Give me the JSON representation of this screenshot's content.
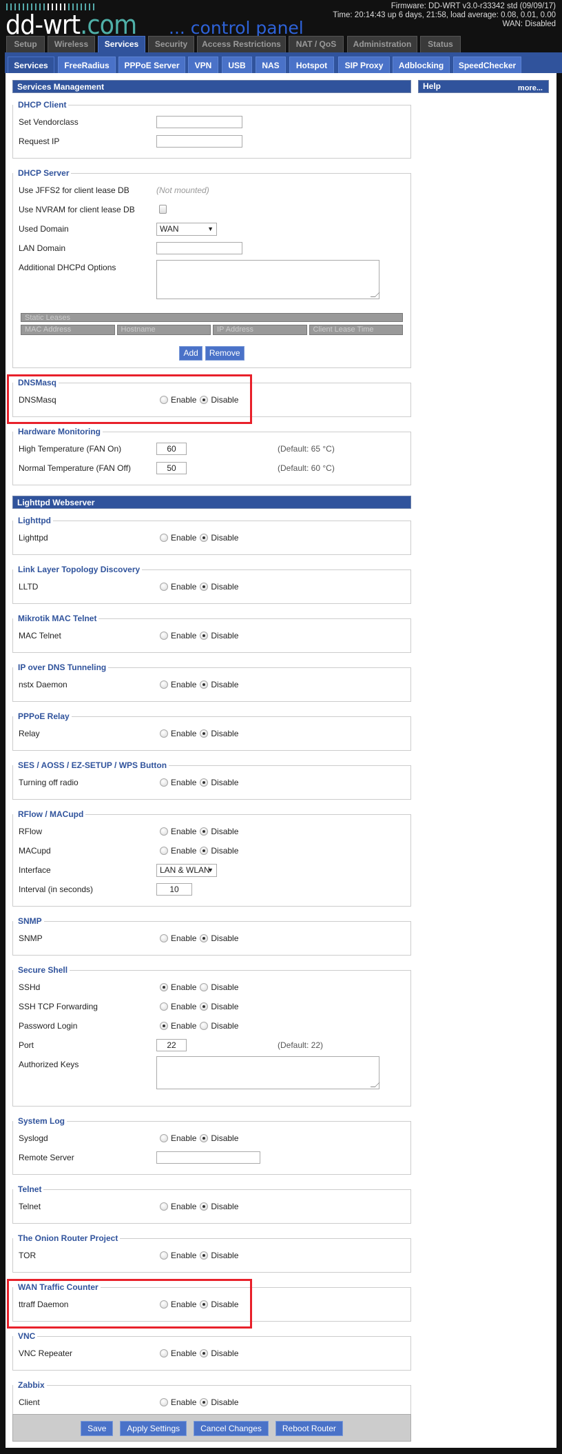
{
  "header": {
    "logo_main": "dd-wrt",
    "logo_suffix": ".com",
    "logo_tagline": "... control panel",
    "firmware": "Firmware: DD-WRT v3.0-r33342 std (09/09/17)",
    "time": "Time: 20:14:43 up 6 days, 21:58, load average: 0.08, 0.01, 0.00",
    "wan": "WAN: Disabled"
  },
  "tabs": [
    {
      "label": "Setup",
      "active": false
    },
    {
      "label": "Wireless",
      "active": false
    },
    {
      "label": "Services",
      "active": true
    },
    {
      "label": "Security",
      "active": false
    },
    {
      "label": "Access Restrictions",
      "active": false
    },
    {
      "label": "NAT / QoS",
      "active": false
    },
    {
      "label": "Administration",
      "active": false
    },
    {
      "label": "Status",
      "active": false
    }
  ],
  "subtabs": [
    {
      "label": "Services",
      "active": true
    },
    {
      "label": "FreeRadius",
      "active": false
    },
    {
      "label": "PPPoE Server",
      "active": false
    },
    {
      "label": "VPN",
      "active": false
    },
    {
      "label": "USB",
      "active": false
    },
    {
      "label": "NAS",
      "active": false
    },
    {
      "label": "Hotspot",
      "active": false
    },
    {
      "label": "SIP Proxy",
      "active": false
    },
    {
      "label": "Adblocking",
      "active": false
    },
    {
      "label": "SpeedChecker",
      "active": false
    }
  ],
  "help": {
    "title": "Help",
    "more": "more..."
  },
  "radio_labels": {
    "enable": "Enable",
    "disable": "Disable"
  },
  "colors": {
    "brand_blue": "#30539c",
    "button_blue": "#4a72c8",
    "highlight_red": "#e8202a"
  },
  "groups": [
    {
      "title": "Services Management",
      "fieldsets": [
        {
          "legend": "DHCP Client",
          "rows": [
            {
              "label": "Set Vendorclass",
              "type": "text",
              "value": ""
            },
            {
              "label": "Request IP",
              "type": "text",
              "value": ""
            }
          ]
        },
        {
          "legend": "DHCP Server",
          "rows": [
            {
              "label": "Use JFFS2 for client lease DB",
              "type": "note",
              "value": "(Not mounted)"
            },
            {
              "label": "Use NVRAM for client lease DB",
              "type": "checkbox",
              "checked": false
            },
            {
              "label": "Used Domain",
              "type": "select",
              "value": "WAN"
            },
            {
              "label": "LAN Domain",
              "type": "text",
              "value": ""
            },
            {
              "label": "Additional DHCPd Options",
              "type": "textarea",
              "value": ""
            }
          ],
          "table": {
            "title": "Static Leases",
            "columns": [
              "MAC Address",
              "Hostname",
              "IP Address",
              "Client Lease Time"
            ]
          },
          "buttons": [
            "Add",
            "Remove"
          ]
        },
        {
          "legend": "DNSMasq",
          "highlighted": true,
          "rows": [
            {
              "label": "DNSMasq",
              "type": "radio",
              "enabled": false
            }
          ]
        },
        {
          "legend": "Hardware Monitoring",
          "rows": [
            {
              "label": "High Temperature (FAN On)",
              "type": "number",
              "value": "60",
              "default": "(Default: 65 °C)"
            },
            {
              "label": "Normal Temperature (FAN Off)",
              "type": "number",
              "value": "50",
              "default": "(Default: 60 °C)"
            }
          ]
        }
      ]
    },
    {
      "title": "Lighttpd Webserver",
      "fieldsets": [
        {
          "legend": "Lighttpd",
          "rows": [
            {
              "label": "Lighttpd",
              "type": "radio",
              "enabled": false
            }
          ]
        },
        {
          "legend": "Link Layer Topology Discovery",
          "rows": [
            {
              "label": "LLTD",
              "type": "radio",
              "enabled": false
            }
          ]
        },
        {
          "legend": "Mikrotik MAC Telnet",
          "rows": [
            {
              "label": "MAC Telnet",
              "type": "radio",
              "enabled": false
            }
          ]
        },
        {
          "legend": "IP over DNS Tunneling",
          "rows": [
            {
              "label": "nstx Daemon",
              "type": "radio",
              "enabled": false
            }
          ]
        },
        {
          "legend": "PPPoE Relay",
          "rows": [
            {
              "label": "Relay",
              "type": "radio",
              "enabled": false
            }
          ]
        },
        {
          "legend": "SES / AOSS / EZ-SETUP / WPS Button",
          "rows": [
            {
              "label": "Turning off radio",
              "type": "radio",
              "enabled": false
            }
          ]
        },
        {
          "legend": "RFlow / MACupd",
          "rows": [
            {
              "label": "RFlow",
              "type": "radio",
              "enabled": false
            },
            {
              "label": "MACupd",
              "type": "radio",
              "enabled": false
            },
            {
              "label": "Interface",
              "type": "select",
              "value": "LAN & WLAN"
            },
            {
              "label": "Interval (in seconds)",
              "type": "number",
              "value": "10"
            }
          ]
        },
        {
          "legend": "SNMP",
          "rows": [
            {
              "label": "SNMP",
              "type": "radio",
              "enabled": false
            }
          ]
        },
        {
          "legend": "Secure Shell",
          "rows": [
            {
              "label": "SSHd",
              "type": "radio",
              "enabled": true
            },
            {
              "label": "SSH TCP Forwarding",
              "type": "radio",
              "enabled": false
            },
            {
              "label": "Password Login",
              "type": "radio",
              "enabled": true
            },
            {
              "label": "Port",
              "type": "number",
              "value": "22",
              "default": "(Default: 22)"
            },
            {
              "label": "Authorized Keys",
              "type": "textarea",
              "value": ""
            }
          ]
        },
        {
          "legend": "System Log",
          "rows": [
            {
              "label": "Syslogd",
              "type": "radio",
              "enabled": false
            },
            {
              "label": "Remote Server",
              "type": "text",
              "value": ""
            }
          ]
        },
        {
          "legend": "Telnet",
          "rows": [
            {
              "label": "Telnet",
              "type": "radio",
              "enabled": false
            }
          ]
        },
        {
          "legend": "The Onion Router Project",
          "rows": [
            {
              "label": "TOR",
              "type": "radio",
              "enabled": false
            }
          ]
        },
        {
          "legend": "WAN Traffic Counter",
          "highlighted": true,
          "rows": [
            {
              "label": "ttraff Daemon",
              "type": "radio",
              "enabled": false
            }
          ]
        },
        {
          "legend": "VNC",
          "rows": [
            {
              "label": "VNC Repeater",
              "type": "radio",
              "enabled": false
            }
          ]
        },
        {
          "legend": "Zabbix",
          "rows": [
            {
              "label": "Client",
              "type": "radio",
              "enabled": false
            }
          ]
        }
      ]
    }
  ],
  "footer": {
    "buttons": [
      "Save",
      "Apply Settings",
      "Cancel Changes",
      "Reboot Router"
    ]
  }
}
